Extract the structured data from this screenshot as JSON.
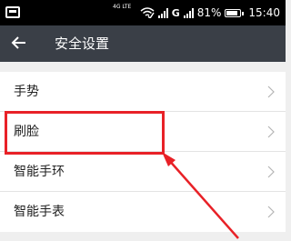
{
  "status_bar": {
    "network_label": "4G LTE",
    "g_label": "G",
    "battery": "81%",
    "time": "15:40"
  },
  "header": {
    "title": "安全设置"
  },
  "settings_list": {
    "items": [
      {
        "label": "手势"
      },
      {
        "label": "刷脸"
      },
      {
        "label": "智能手环"
      },
      {
        "label": "智能手表"
      }
    ]
  },
  "annotation": {
    "color": "#e82127"
  }
}
